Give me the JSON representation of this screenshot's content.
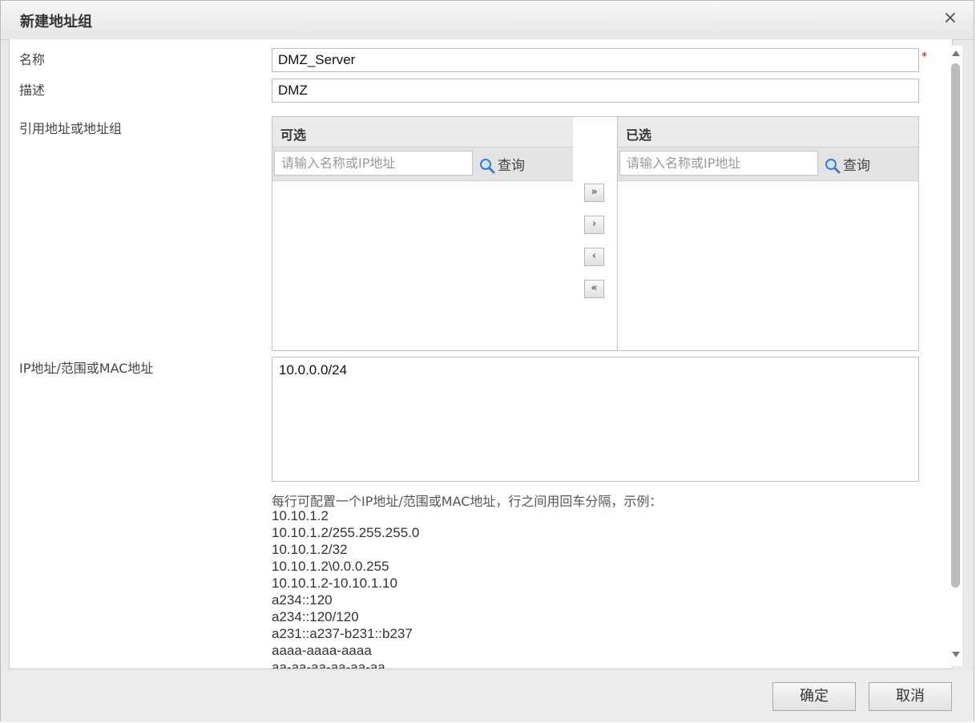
{
  "dialog": {
    "title": "新建地址组",
    "close_icon": "×"
  },
  "form": {
    "name_label": "名称",
    "name_value": "DMZ_Server",
    "required_mark": "*",
    "desc_label": "描述",
    "desc_value": "DMZ",
    "ref_label": "引用地址或地址组",
    "ip_label": "IP地址/范围或MAC地址",
    "ip_value": "10.0.0.0/24"
  },
  "available": {
    "header": "可选",
    "placeholder": "请输入名称或IP地址",
    "query_label": "查询"
  },
  "selected": {
    "header": "已选",
    "placeholder": "请输入名称或IP地址",
    "query_label": "查询"
  },
  "transfer": {
    "add_all": "»",
    "add": "›",
    "remove": "‹",
    "remove_all": "«"
  },
  "hint": "每行可配置一个IP地址/范围或MAC地址，行之间用回车分隔，示例：",
  "examples": [
    "10.10.1.2",
    "10.10.1.2/255.255.255.0",
    "10.10.1.2/32",
    "10.10.1.2\\0.0.0.255",
    "10.10.1.2-10.10.1.10",
    "a234::120",
    "a234::120/120",
    "a231::a237-b231::b237",
    "aaaa-aaaa-aaaa",
    "aa-aa-aa-aa-aa-aa"
  ],
  "footer": {
    "ok_label": "确定",
    "cancel_label": "取消"
  }
}
